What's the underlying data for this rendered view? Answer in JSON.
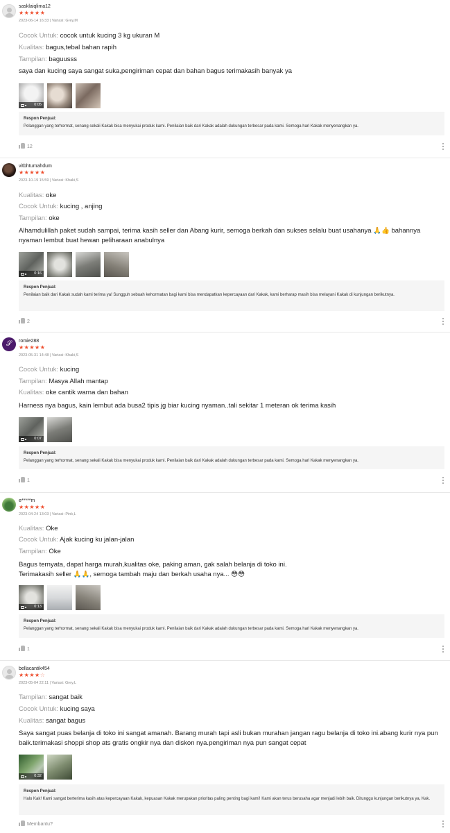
{
  "star_color": "#ee4d2d",
  "reviews": [
    {
      "username": "sasklaiqlima12",
      "avatar": "default-avatar",
      "stars": "★★★★★",
      "stars_off": "",
      "meta": "2023-06-14 16:33 | Variasi: Grey,M",
      "attrs": [
        {
          "label": "Cocok Untuk:",
          "value": "cocok untuk kucing 3 kg ukuran M"
        },
        {
          "label": "Kualitas:",
          "value": "bagus,tebal bahan rapih"
        },
        {
          "label": "Tampilan:",
          "value": "baguusss"
        }
      ],
      "text": "saya dan kucing saya sangat suka,pengiriman cepat dan bahan bagus terimakasih banyak ya",
      "media": [
        {
          "duration": "0:05"
        }
      ],
      "seller_title": "Respon Penjual:",
      "seller_text": "Pelanggan yang terhormat, senang sekali Kakak bisa menyukai produk kami. Penilaian baik dari Kakak adalah dukungan terbesar pada kami. Semoga hari Kakak menyenangkan ya.",
      "likes": "12"
    },
    {
      "username": "vitbhtumahdum",
      "stars": "★★★★★",
      "stars_off": "",
      "meta": "2023-10-19 15:59 | Variasi: Khaki,S",
      "attrs": [
        {
          "label": "Kualitas:",
          "value": "oke"
        },
        {
          "label": "Cocok Untuk:",
          "value": "kucing , anjing"
        },
        {
          "label": "Tampilan:",
          "value": "oke"
        }
      ],
      "text": "Alhamdulillah paket sudah sampai, terima kasih seller dan Abang kurir, semoga berkah dan sukses selalu buat usahanya 🙏👍  bahannya nyaman lembut buat hewan peliharaan anabulnya",
      "media": [
        {
          "duration": "0:16"
        }
      ],
      "seller_title": "Respon Penjual:",
      "seller_text": "Penilaian baik dari Kakak sudah kami terima ya! Sungguh sebuah kehormatan bagi kami bisa mendapatkan kepercayaan dari Kakak, kami berharap masih bisa melayani Kakak di kunjungan berikutnya.",
      "likes": "2"
    },
    {
      "username": "romie288",
      "avatar_glyph": "𝒮",
      "stars": "★★★★★",
      "stars_off": "",
      "meta": "2023-05-31 14:48 | Variasi: Khaki,S",
      "attrs": [
        {
          "label": "Cocok Untuk:",
          "value": "kucing"
        },
        {
          "label": "Tampilan:",
          "value": "Masya Allah mantap"
        },
        {
          "label": "Kualitas:",
          "value": "oke cantik warna dan bahan"
        }
      ],
      "text": "Harness nya bagus, kain lembut ada busa2 tipis jg biar kucing nyaman..tali sekitar 1 meteran ok terima kasih",
      "media": [
        {
          "duration": "0:07"
        }
      ],
      "seller_title": "Respon Penjual:",
      "seller_text": "Pelanggan yang terhormat, senang sekali Kakak bisa menyukai produk kami. Penilaian baik dari Kakak adalah dukungan terbesar pada kami. Semoga hari Kakak menyenangkan ya.",
      "likes": "1"
    },
    {
      "username": "e*****m",
      "stars": "★★★★★",
      "stars_off": "",
      "meta": "2023-04-24 13:03 | Variasi: Pink,L",
      "attrs": [
        {
          "label": "Kualitas:",
          "value": "Oke"
        },
        {
          "label": "Cocok Untuk:",
          "value": "Ajak kucing ku jalan-jalan"
        },
        {
          "label": "Tampilan:",
          "value": "Oke"
        }
      ],
      "text": "Bagus ternyata, dapat harga murah,kualitas oke, paking aman, gak salah belanja di toko ini.\nTerimakasih seller 🙏🙏, semoga tambah maju dan berkah usaha nya... 😳😳",
      "media": [
        {
          "duration": "0:13"
        }
      ],
      "seller_title": "Respon Penjual:",
      "seller_text": "Pelanggan yang terhormat, senang sekali Kakak bisa menyukai produk kami. Penilaian baik dari Kakak adalah dukungan terbesar pada kami. Semoga hari Kakak menyenangkan ya.",
      "likes": "1"
    },
    {
      "username": "bellacantik454",
      "avatar": "default-avatar",
      "stars": "★★★★",
      "stars_off": "☆",
      "meta": "2023-05-04 22:11 | Variasi: Grey,L",
      "attrs": [
        {
          "label": "Tampilan:",
          "value": "sangat baik"
        },
        {
          "label": "Cocok Untuk:",
          "value": "kucing saya"
        },
        {
          "label": "Kualitas:",
          "value": "sangat bagus"
        }
      ],
      "text": "Saya sangat puas belanja di toko ini sangat amanah. Barang murah tapi asli bukan murahan jangan ragu belanja di toko ini.abang kurir nya pun baik.terimakasi shoppi shop ats gratis ongkir nya dan diskon nya.pengiriman nya pun sangat cepat",
      "media": [
        {
          "duration": "0:32"
        }
      ],
      "seller_title": "Respon Penjual:",
      "seller_text": "Halo Kak! Kami sangat berterima kasih atas kepercayaan Kakak, kepuasan Kakak merupakan prioritas paling penting bagi kami! Kami akan terus berusaha agar menjadi lebih baik. Ditunggu kunjungan berikutnya ya, Kak.",
      "likes": "Membantu?"
    }
  ]
}
